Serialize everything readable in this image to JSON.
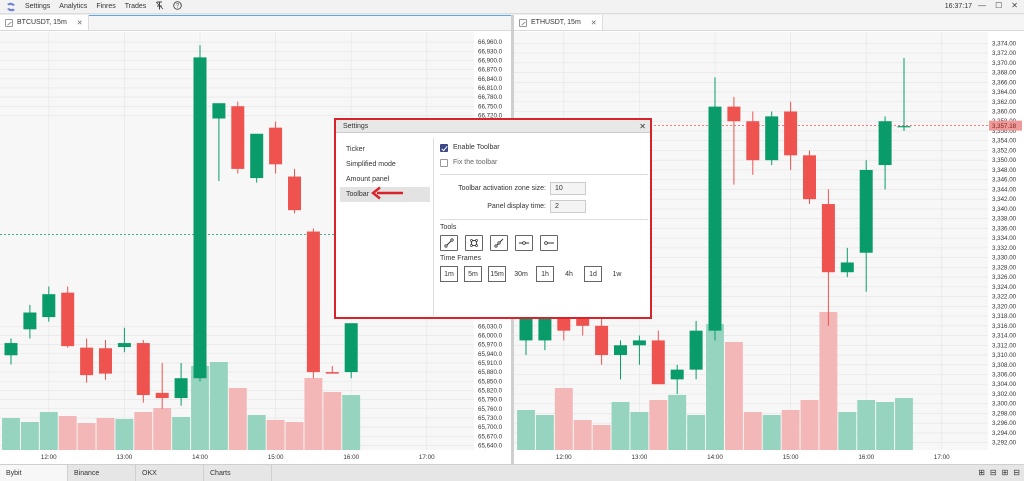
{
  "menu": {
    "items": [
      "Settings",
      "Analytics",
      "Finres",
      "Trades"
    ],
    "icons": [
      "pin-icon",
      "help-icon"
    ],
    "clock": "16:37:17",
    "window_controls": [
      "minimize-icon",
      "maximize-icon",
      "close-icon"
    ]
  },
  "left_tab": {
    "label": "BTCUSDT, 15m"
  },
  "right_tab": {
    "label": "ETHUSDT, 15m"
  },
  "exchanges": [
    "Bybit",
    "Binance",
    "OKX",
    "Charts"
  ],
  "colors": {
    "up": "#0a9b6a",
    "down": "#ef5350",
    "vol_up": "#96d4bf",
    "vol_down": "#f2b7b6",
    "price_label_bg": "#ef9a98",
    "dialog_border": "#d9232b"
  },
  "dialog": {
    "title": "Settings",
    "nav": [
      "Ticker",
      "Simplified mode",
      "Amount panel",
      "Toolbar"
    ],
    "selected": "Toolbar",
    "enable_toolbar": {
      "label": "Enable Toolbar",
      "checked": true
    },
    "fix_toolbar": {
      "label": "Fix the toolbar",
      "checked": false
    },
    "activation_zone_label": "Toolbar activation zone size:",
    "activation_zone_value": "10",
    "display_time_label": "Panel display time:",
    "display_time_value": "2",
    "tools_label": "Tools",
    "tools": [
      "segment-tool-icon",
      "rectangle-tool-icon",
      "ray-tool-icon",
      "horizontal-line-tool-icon",
      "horizontal-ray-tool-icon"
    ],
    "timeframes_label": "Time Frames",
    "timeframes": [
      {
        "label": "1m",
        "on": true
      },
      {
        "label": "5m",
        "on": true
      },
      {
        "label": "15m",
        "on": true
      },
      {
        "label": "30m",
        "on": false
      },
      {
        "label": "1h",
        "on": true
      },
      {
        "label": "4h",
        "on": false
      },
      {
        "label": "1d",
        "on": true
      },
      {
        "label": "1w",
        "on": false
      }
    ]
  },
  "chart_data": [
    {
      "type": "candlestick",
      "symbol": "BTCUSDT",
      "timeframe": "15m",
      "x_ticks": [
        "12:00",
        "13:00",
        "14:00",
        "15:00",
        "16:00",
        "17:00"
      ],
      "y_ticks_upper": [
        66960.0,
        66930.0,
        66900.0,
        66870.0,
        66840.0,
        66810.0,
        66780.0,
        66750.0,
        66720.0
      ],
      "y_ticks_lower": [
        66030.0,
        66000.0,
        65970.0,
        65940.0,
        65910.0,
        65880.0,
        65850.0,
        65820.0,
        65790.0,
        65760.0,
        65730.0,
        65700.0,
        65670.0,
        65640.0
      ],
      "y_tick_labels_upper": [
        "66,960.0",
        "66,930.0",
        "66,900.0",
        "66,870.0",
        "66,840.0",
        "66,810.0",
        "66,780.0",
        "66,750.0",
        "66,720.0"
      ],
      "y_tick_labels_lower": [
        "66,030.0",
        "66,000.0",
        "65,970.0",
        "65,940.0",
        "65,910.0",
        "65,880.0",
        "65,850.0",
        "65,820.0",
        "65,790.0",
        "65,760.0",
        "65,730.0",
        "65,700.0",
        "65,670.0",
        "65,640.0"
      ],
      "ylim": [
        65625,
        66980
      ],
      "grid": true,
      "current_price_line": 66330,
      "candles": [
        {
          "t": "11:30",
          "o": 65935,
          "h": 65990,
          "l": 65905,
          "c": 65975
        },
        {
          "t": "11:45",
          "o": 66020,
          "h": 66100,
          "l": 65990,
          "c": 66075
        },
        {
          "t": "12:00",
          "o": 66060,
          "h": 66160,
          "l": 66045,
          "c": 66135
        },
        {
          "t": "12:15",
          "o": 66140,
          "h": 66160,
          "l": 65960,
          "c": 65965
        },
        {
          "t": "12:30",
          "o": 65960,
          "h": 65990,
          "l": 65845,
          "c": 65870
        },
        {
          "t": "12:45",
          "o": 65958,
          "h": 65985,
          "l": 65855,
          "c": 65875
        },
        {
          "t": "13:00",
          "o": 65962,
          "h": 66025,
          "l": 65945,
          "c": 65975
        },
        {
          "t": "13:15",
          "o": 65975,
          "h": 65985,
          "l": 65780,
          "c": 65805
        },
        {
          "t": "13:30",
          "o": 65812,
          "h": 65910,
          "l": 65760,
          "c": 65795
        },
        {
          "t": "13:45",
          "o": 65795,
          "h": 65910,
          "l": 65770,
          "c": 65860
        },
        {
          "t": "14:00",
          "o": 65860,
          "h": 66950,
          "l": 65850,
          "c": 66910
        },
        {
          "t": "14:15",
          "o": 66710,
          "h": 66760,
          "l": 66505,
          "c": 66760
        },
        {
          "t": "14:30",
          "o": 66750,
          "h": 66765,
          "l": 66530,
          "c": 66545
        },
        {
          "t": "14:45",
          "o": 66515,
          "h": 66535,
          "l": 66500,
          "c": 66660
        },
        {
          "t": "15:00",
          "o": 66680,
          "h": 66700,
          "l": 66530,
          "c": 66560
        },
        {
          "t": "15:15",
          "o": 66520,
          "h": 66545,
          "l": 66400,
          "c": 66410
        },
        {
          "t": "15:30",
          "o": 66340,
          "h": 66350,
          "l": 65860,
          "c": 65880
        },
        {
          "t": "15:45",
          "o": 65880,
          "h": 65900,
          "l": 65875,
          "c": 65875
        },
        {
          "t": "16:00",
          "o": 65880,
          "h": 65920,
          "l": 65860,
          "c": 66040
        }
      ]
    },
    {
      "type": "candlestick",
      "symbol": "ETHUSDT",
      "timeframe": "15m",
      "x_ticks": [
        "12:00",
        "13:00",
        "14:00",
        "15:00",
        "16:00",
        "17:00"
      ],
      "y_ticks": [
        3374.0,
        3372.0,
        3370.0,
        3368.0,
        3366.0,
        3364.0,
        3362.0,
        3360.0,
        3358.0,
        3356.0,
        3354.0,
        3352.0,
        3350.0,
        3348.0,
        3346.0,
        3344.0,
        3342.0,
        3340.0,
        3338.0,
        3336.0,
        3334.0,
        3332.0,
        3330.0,
        3328.0,
        3326.0,
        3324.0,
        3322.0,
        3320.0,
        3318.0,
        3316.0,
        3314.0,
        3312.0,
        3310.0,
        3308.0,
        3306.0,
        3304.0,
        3302.0,
        3300.0,
        3298.0,
        3296.0,
        3294.0,
        3292.0
      ],
      "y_tick_labels": [
        "3,374.00",
        "3,372.00",
        "3,370.00",
        "3,368.00",
        "3,366.00",
        "3,364.00",
        "3,362.00",
        "3,360.00",
        "3,358.00",
        "3,356.00",
        "3,354.00",
        "3,352.00",
        "3,350.00",
        "3,348.00",
        "3,346.00",
        "3,344.00",
        "3,342.00",
        "3,340.00",
        "3,338.00",
        "3,336.00",
        "3,334.00",
        "3,332.00",
        "3,330.00",
        "3,328.00",
        "3,326.00",
        "3,324.00",
        "3,322.00",
        "3,320.00",
        "3,318.00",
        "3,316.00",
        "3,314.00",
        "3,312.00",
        "3,310.00",
        "3,308.00",
        "3,306.00",
        "3,304.00",
        "3,302.00",
        "3,300.00",
        "3,298.00",
        "3,296.00",
        "3,294.00",
        "3,292.00"
      ],
      "ylim": [
        3290.5,
        3375.5
      ],
      "grid": true,
      "last_price": 3357.1,
      "last_price_label": "3,357.18",
      "candles": [
        {
          "t": "11:30",
          "o": 3313,
          "h": 3318,
          "l": 3310,
          "c": 3318
        },
        {
          "t": "11:45",
          "o": 3313,
          "h": 3318,
          "l": 3311,
          "c": 3318
        },
        {
          "t": "12:00",
          "o": 3318,
          "h": 3320,
          "l": 3313,
          "c": 3315
        },
        {
          "t": "12:15",
          "o": 3318,
          "h": 3319,
          "l": 3314,
          "c": 3316
        },
        {
          "t": "12:30",
          "o": 3316,
          "h": 3318,
          "l": 3308,
          "c": 3310
        },
        {
          "t": "12:45",
          "o": 3310,
          "h": 3313,
          "l": 3305,
          "c": 3312
        },
        {
          "t": "13:00",
          "o": 3312,
          "h": 3314,
          "l": 3308,
          "c": 3313
        },
        {
          "t": "13:15",
          "o": 3313,
          "h": 3315,
          "l": 3305,
          "c": 3304
        },
        {
          "t": "13:30",
          "o": 3305,
          "h": 3308,
          "l": 3302,
          "c": 3307
        },
        {
          "t": "13:45",
          "o": 3307,
          "h": 3317,
          "l": 3305,
          "c": 3315
        },
        {
          "t": "14:00",
          "o": 3315,
          "h": 3367,
          "l": 3313,
          "c": 3361
        },
        {
          "t": "14:15",
          "o": 3361,
          "h": 3363,
          "l": 3345,
          "c": 3358
        },
        {
          "t": "14:30",
          "o": 3358,
          "h": 3360,
          "l": 3347,
          "c": 3350
        },
        {
          "t": "14:45",
          "o": 3350,
          "h": 3360,
          "l": 3349,
          "c": 3359
        },
        {
          "t": "15:00",
          "o": 3360,
          "h": 3362,
          "l": 3348,
          "c": 3351
        },
        {
          "t": "15:15",
          "o": 3351,
          "h": 3352,
          "l": 3341,
          "c": 3342
        },
        {
          "t": "15:30",
          "o": 3341,
          "h": 3344,
          "l": 3316,
          "c": 3327
        },
        {
          "t": "15:45",
          "o": 3327,
          "h": 3332,
          "l": 3326,
          "c": 3329
        },
        {
          "t": "16:00",
          "o": 3331,
          "h": 3350,
          "l": 3323,
          "c": 3348
        },
        {
          "t": "16:15",
          "o": 3349,
          "h": 3359,
          "l": 3344,
          "c": 3358
        },
        {
          "t": "16:30",
          "o": 3357,
          "h": 3371,
          "l": 3356,
          "c": 3357
        }
      ]
    }
  ]
}
